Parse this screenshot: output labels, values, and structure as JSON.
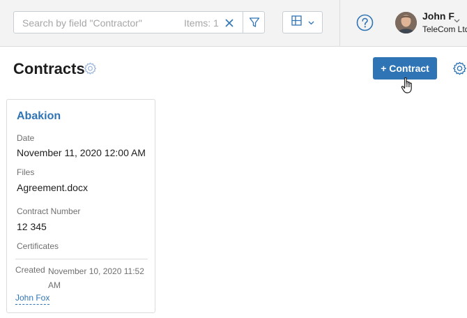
{
  "toolbar": {
    "search": {
      "placeholder": "Search by field \"Contractor\"",
      "value": "",
      "items_label": "Items: 1",
      "clear_icon": "close-icon",
      "filter_icon": "filter-icon"
    },
    "view_switcher": {
      "icon": "grid-view-icon",
      "chevron": "chevron-down-icon"
    },
    "help_icon": "help-icon"
  },
  "user": {
    "name": "John F",
    "company": "TeleCom Ltd.",
    "avatar": "user-avatar"
  },
  "page": {
    "title": "Contracts",
    "add_button": "+ Contract"
  },
  "card": {
    "title": "Abakion",
    "fields": [
      {
        "label": "Date",
        "value": "November 11, 2020 12:00 AM"
      },
      {
        "label": "Files",
        "value": "Agreement.docx"
      },
      {
        "label": "Contract Number",
        "value": "12 345"
      },
      {
        "label": "Certificates",
        "value": ""
      }
    ],
    "created_label": "Created",
    "created_value": "November 10, 2020 11:52 AM",
    "author": "John Fox"
  },
  "colors": {
    "accent": "#2f74b5",
    "topbar_bg": "#f3f3f3",
    "text": "#1d1d1f",
    "muted": "#6f6f6f",
    "gear": "#9db7dc"
  }
}
